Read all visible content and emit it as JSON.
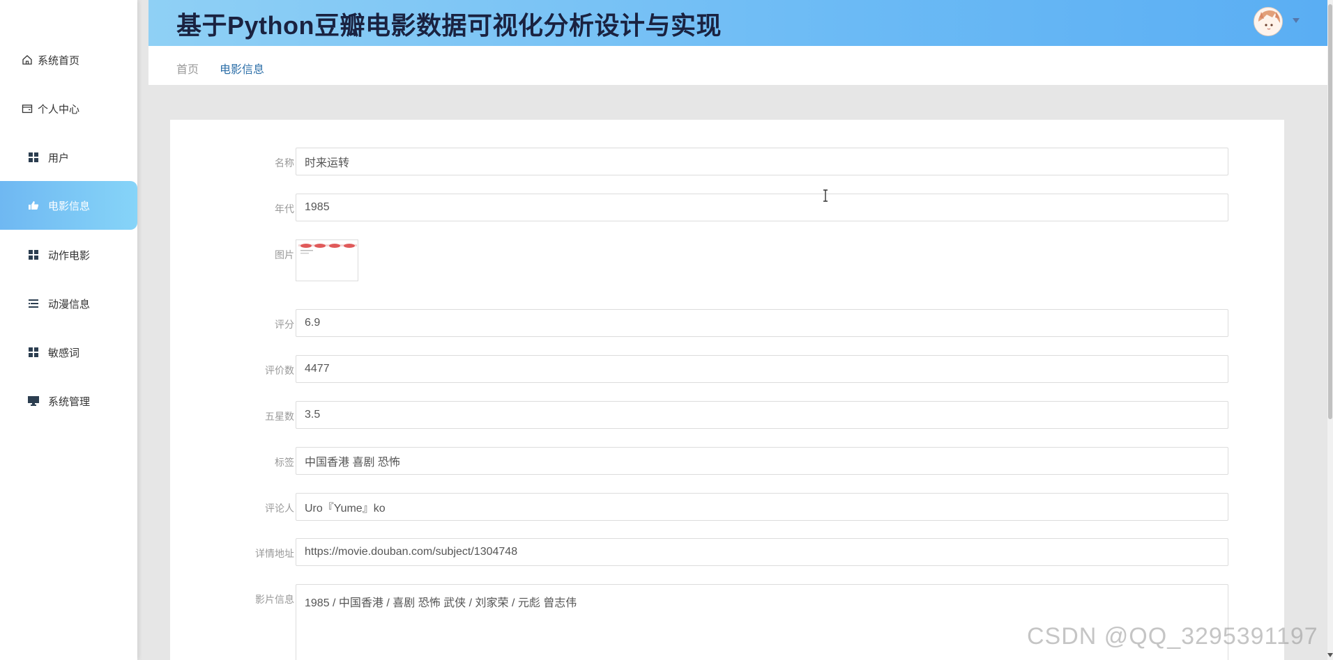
{
  "app_title": "基于Python豆瓣电影数据可视化分析设计与实现",
  "sidebar": {
    "items": [
      {
        "label": "系统首页",
        "icon": "home-icon"
      },
      {
        "label": "个人中心",
        "icon": "wallet-icon"
      },
      {
        "label": "用户",
        "icon": "grid-icon"
      },
      {
        "label": "电影信息",
        "icon": "thumb-icon",
        "active": true
      },
      {
        "label": "动作电影",
        "icon": "grid-icon"
      },
      {
        "label": "动漫信息",
        "icon": "list-icon"
      },
      {
        "label": "敏感词",
        "icon": "grid-icon"
      },
      {
        "label": "系统管理",
        "icon": "monitor-icon"
      }
    ]
  },
  "breadcrumb": {
    "home": "首页",
    "current": "电影信息"
  },
  "form": {
    "name": {
      "label": "名称",
      "value": "时来运转"
    },
    "year": {
      "label": "年代",
      "value": "1985"
    },
    "image": {
      "label": "图片"
    },
    "rating": {
      "label": "评分",
      "value": "6.9"
    },
    "reviews": {
      "label": "评价数",
      "value": "4477"
    },
    "five_star": {
      "label": "五星数",
      "value": "3.5"
    },
    "tags": {
      "label": "标签",
      "value": "中国香港 喜剧 恐怖"
    },
    "reviewer": {
      "label": "评论人",
      "value": "Uro『Yume』ko"
    },
    "url": {
      "label": "详情地址",
      "value": "https://movie.douban.com/subject/1304748"
    },
    "info": {
      "label": "影片信息",
      "value": "1985 / 中国香港 / 喜剧 恐怖 武侠 / 刘家荣 / 元彪 曾志伟"
    }
  },
  "watermark": "CSDN @QQ_3295391197",
  "colors": {
    "accent": "#6bbaf5",
    "active_item": "#7ec6f6",
    "crumb_current": "#2d6fa8"
  }
}
